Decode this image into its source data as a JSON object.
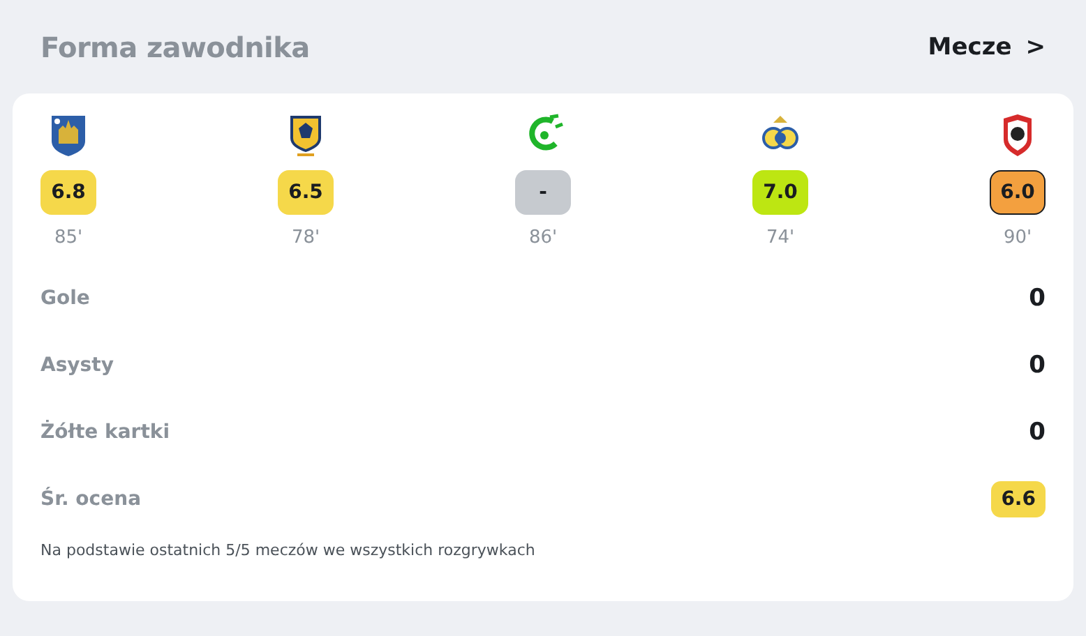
{
  "header": {
    "title": "Forma zawodnika",
    "link": "Mecze",
    "link_icon": ">"
  },
  "matches": [
    {
      "kind": "blue-shield",
      "rating": "6.8",
      "color": "#f5d84a",
      "minutes": "85'",
      "selected": false
    },
    {
      "kind": "gold-shield",
      "rating": "6.5",
      "color": "#f5d84a",
      "minutes": "78'",
      "selected": false
    },
    {
      "kind": "green-emblem",
      "rating": "-",
      "color": "#c6cacf",
      "minutes": "86'",
      "selected": false
    },
    {
      "kind": "round-crest",
      "rating": "7.0",
      "color": "#bde612",
      "minutes": "74'",
      "selected": false
    },
    {
      "kind": "red-shield",
      "rating": "6.0",
      "color": "#f3a03f",
      "minutes": "90'",
      "selected": true
    }
  ],
  "stats": [
    {
      "kind": "number",
      "label": "Gole",
      "value": "0"
    },
    {
      "kind": "number",
      "label": "Asysty",
      "value": "0"
    },
    {
      "kind": "number",
      "label": "Żółte kartki",
      "value": "0"
    },
    {
      "kind": "rating",
      "label": "Śr. ocena",
      "value": "6.6",
      "color": "#f5d84a"
    }
  ],
  "footnote": "Na podstawie ostatnich 5/5 meczów we wszystkich rozgrywkach"
}
